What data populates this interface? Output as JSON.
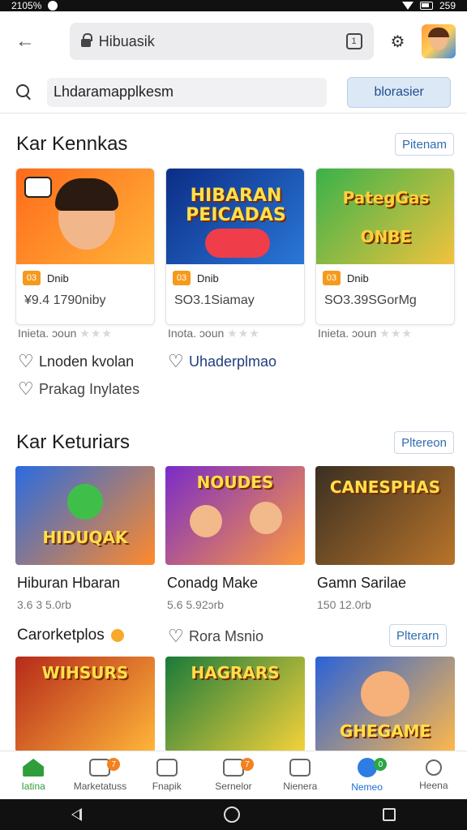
{
  "status_bar": {
    "time": "2105%",
    "battery": "259"
  },
  "browser": {
    "url": "Hibuasik",
    "tab_count": "1"
  },
  "search": {
    "value": "Lhdaramapplkesm",
    "button_label": "blorasier"
  },
  "sections": [
    {
      "title": "Kar Kennkas",
      "more_label": "Pitenam"
    },
    {
      "title": "Kar Keturiars",
      "more_label": "Pltereon"
    }
  ],
  "featured_cards": [
    {
      "badge": "03",
      "badge_label": "Dnib",
      "sub": "¥9.4 1790niby",
      "rating_text": "Inieta. ɔoun",
      "stars": "★★★",
      "thumb_text": "",
      "colors": [
        "#ff6a1a",
        "#ffb43a"
      ]
    },
    {
      "badge": "03",
      "badge_label": "Dnib",
      "sub": "SO3.1Siamay",
      "rating_text": "Inota. ɔoun",
      "stars": "★★★",
      "thumb_text": "HIBARAN PEICADAS",
      "colors": [
        "#0c2d86",
        "#2a78d8"
      ]
    },
    {
      "badge": "03",
      "badge_label": "Dnib",
      "sub": "SO3.39SGorMg",
      "rating_text": "Inieta. ɔoun",
      "stars": "★★★",
      "thumb_text": "PategGas ONBE",
      "colors": [
        "#39b24a",
        "#f2c33d"
      ]
    }
  ],
  "heart_links": [
    {
      "label": "Lnoden kvolan"
    },
    {
      "label": "Uhaderplmao"
    },
    {
      "label": "Prakag Inylates"
    }
  ],
  "games_row_1": [
    {
      "title": "Hiburan Hbaran",
      "meta": "3.6 3 5.0rb",
      "thumb_text": "HIDUQAK",
      "colors": [
        "#2a6be0",
        "#ff8a2a"
      ]
    },
    {
      "title": "Conadg Make",
      "meta": "5.6 5.92ɔrb",
      "thumb_text": "NOUDES",
      "colors": [
        "#7a2bc9",
        "#ff9a3c"
      ]
    },
    {
      "title": "Gamn Sarilae",
      "meta": "150 12.0rb",
      "thumb_text": "CANESPHAS",
      "colors": [
        "#3a2f22",
        "#b8742a"
      ]
    }
  ],
  "subsection": {
    "title": "Carorketplos",
    "heart_label": "Rora Msnio",
    "more_label": "Plterarn"
  },
  "games_row_2": [
    {
      "thumb_text": "WIHSURS",
      "colors": [
        "#b62a1a",
        "#ffb63a"
      ]
    },
    {
      "thumb_text": "HAGRARS",
      "colors": [
        "#1a7a3a",
        "#f5d23a"
      ]
    },
    {
      "thumb_text": "GHEGAME",
      "colors": [
        "#2a62d8",
        "#ffb84a"
      ]
    }
  ],
  "nav": [
    {
      "label": "Iatina",
      "icon": "home-icon"
    },
    {
      "label": "Marketatuss",
      "icon": "market-icon",
      "badge": "7"
    },
    {
      "label": "Fnapik",
      "icon": "chart-icon"
    },
    {
      "label": "Sernelor",
      "icon": "camera-icon",
      "badge": "7"
    },
    {
      "label": "Nienera",
      "icon": "gallery-icon"
    },
    {
      "label": "Nemeo",
      "icon": "account-icon",
      "badge": "0"
    },
    {
      "label": "Heena",
      "icon": "profile-icon"
    }
  ]
}
